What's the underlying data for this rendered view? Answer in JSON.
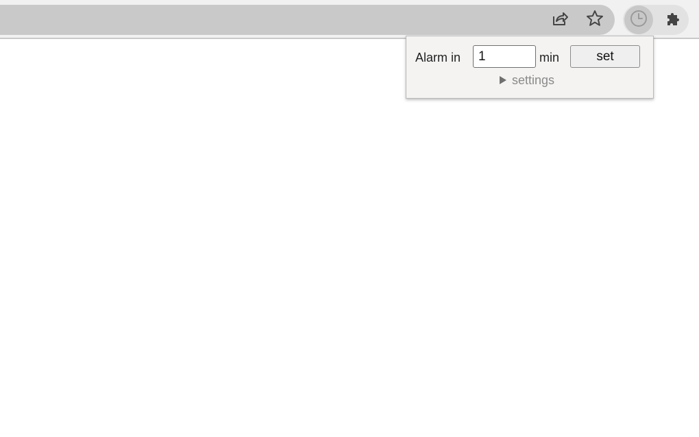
{
  "toolbar": {
    "share_icon": "share-icon",
    "bookmark_icon": "star-icon",
    "extension_icon": "clock-icon",
    "extensions_menu_icon": "puzzle-icon"
  },
  "popup": {
    "alarm_label": "Alarm in",
    "minutes_value": "1",
    "unit_label": "min",
    "set_label": "set",
    "settings_label": "settings"
  }
}
